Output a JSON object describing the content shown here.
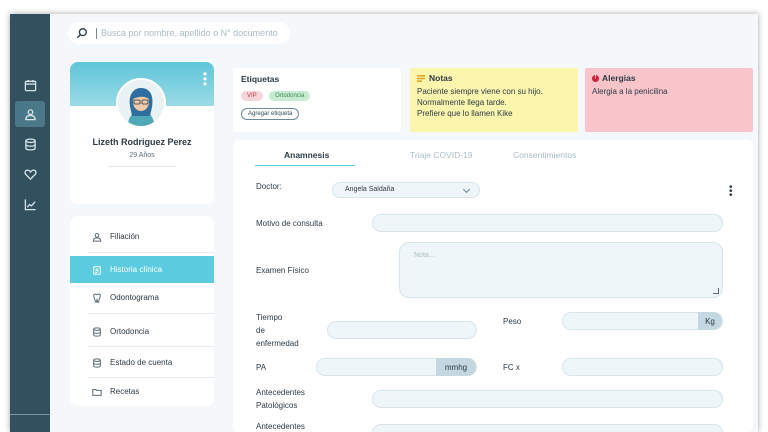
{
  "search": {
    "placeholder": "Busca por nombre, apellido o N° documento"
  },
  "rail": {
    "icons": [
      "calendar-icon",
      "user-icon",
      "database-icon",
      "heart-icon",
      "chart-icon"
    ]
  },
  "profile": {
    "name": "Lizeth Rodriguez Perez",
    "age": "29 Años"
  },
  "menu": {
    "items": [
      {
        "label": "Filiación",
        "icon": "user-icon"
      },
      {
        "label": "Historia clínica",
        "icon": "clipboard-icon"
      },
      {
        "label": "Odontograma",
        "icon": "tooth-icon"
      },
      {
        "label": "Ortodoncia",
        "icon": "database-icon"
      },
      {
        "label": "Estado de cuenta",
        "icon": "database-icon"
      },
      {
        "label": "Recetas",
        "icon": "folder-icon"
      }
    ]
  },
  "tags": {
    "title": "Etiquetas",
    "items": [
      "VIP",
      "Ortodoncia"
    ],
    "add_label": "Agregar etiqueta"
  },
  "notes": {
    "title": "Notas",
    "lines": [
      "Paciente siempre viene con su hijo.",
      "Normalmente llega tarde.",
      "Prefiere que lo llamen Kike"
    ]
  },
  "allergies": {
    "title": "Alergias",
    "text": "Alergia a la penicilina"
  },
  "tabs": [
    "Anamnesis",
    "Triaje COVID-19",
    "Consentimientos"
  ],
  "form": {
    "doctor_label": "Doctor:",
    "doctor_value": "Angela Saldaña",
    "motivo_label": "Motivo de consulta",
    "examen_label": "Examen Físico",
    "examen_placeholder": "Nota...",
    "tiempo_label_1": "Tiempo",
    "tiempo_label_2": "de",
    "tiempo_label_3": "enfermedad",
    "peso_label": "Peso",
    "peso_unit": "Kg",
    "pa_label": "PA",
    "pa_unit": "mmhg",
    "fc_label": "FC x",
    "ant_pat_label_1": "Antecedentes",
    "ant_pat_label_2": "Patológicos",
    "ant_label_3": "Antecedentes"
  },
  "colors": {
    "accent": "#5bcbe0",
    "rail": "#32505e",
    "notes_bg": "#fbf5ad",
    "allergy_bg": "#f9c5cb"
  }
}
